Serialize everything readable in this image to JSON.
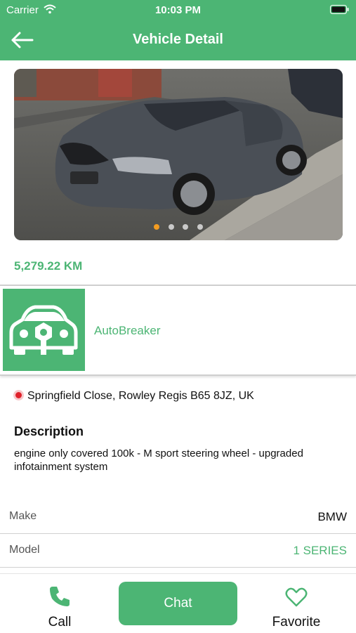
{
  "status_bar": {
    "carrier": "Carrier",
    "time": "10:03 PM"
  },
  "nav": {
    "title": "Vehicle Detail",
    "back_icon": "arrow-left-icon"
  },
  "photo": {
    "slides": 4,
    "active_slide": 1,
    "subject": "dark grey BMW 1 Series hatchback"
  },
  "mileage": "5,279.22 KM",
  "seller": {
    "name": "AutoBreaker",
    "logo_icon": "car-wrench-icon"
  },
  "location": {
    "address": "Springfield Close, Rowley Regis B65 8JZ, UK",
    "icon": "pin-icon"
  },
  "description": {
    "heading": "Description",
    "text": "engine only covered 100k - M sport steering wheel - upgraded infotainment system"
  },
  "specs": [
    {
      "label": "Make",
      "value": "BMW"
    },
    {
      "label": "Model",
      "value": "1 SERIES"
    }
  ],
  "actions": {
    "call_label": "Call",
    "chat_label": "Chat",
    "favorite_label": "Favorite"
  },
  "colors": {
    "brand": "#4cb574",
    "dot_active": "#f39c21",
    "pin": "#e0202a"
  }
}
